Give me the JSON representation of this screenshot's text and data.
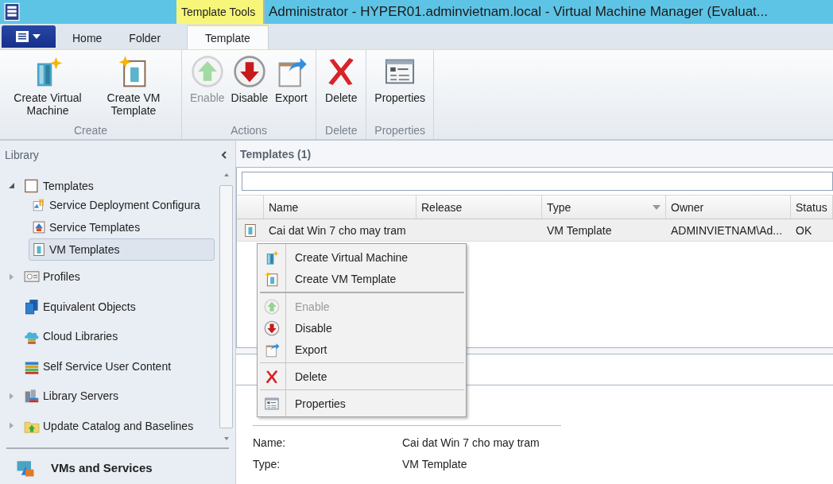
{
  "window": {
    "title": "Administrator - HYPER01.adminvietnam.local - Virtual Machine Manager (Evaluat..."
  },
  "contextual_tab_group": "Template Tools",
  "ribbon_tabs": [
    {
      "label": "Home",
      "selected": false
    },
    {
      "label": "Folder",
      "selected": false
    },
    {
      "label": "Template",
      "selected": true
    }
  ],
  "ribbon_groups": [
    {
      "label": "Create",
      "buttons": [
        {
          "label": "Create Virtual Machine",
          "kind": "server-star",
          "disabled": false
        },
        {
          "label": "Create VM Template",
          "kind": "template-star",
          "disabled": false
        }
      ]
    },
    {
      "label": "Actions",
      "buttons": [
        {
          "label": "Enable",
          "kind": "enable",
          "disabled": true
        },
        {
          "label": "Disable",
          "kind": "disable",
          "disabled": false
        },
        {
          "label": "Export",
          "kind": "export",
          "disabled": false
        }
      ]
    },
    {
      "label": "Delete",
      "buttons": [
        {
          "label": "Delete",
          "kind": "delete",
          "disabled": false
        }
      ]
    },
    {
      "label": "Properties",
      "buttons": [
        {
          "label": "Properties",
          "kind": "properties",
          "disabled": false
        }
      ]
    }
  ],
  "sidebar": {
    "title": "Library",
    "tree": [
      {
        "label": "Templates",
        "kind": "template-box",
        "expanded": true,
        "selected": false,
        "children": [
          {
            "label": "Service Deployment Configura",
            "kind": "config",
            "selected": false
          },
          {
            "label": "Service Templates",
            "kind": "service",
            "selected": false
          },
          {
            "label": "VM Templates",
            "kind": "vm-template",
            "selected": true
          }
        ]
      },
      {
        "label": "Profiles",
        "kind": "profile",
        "expanded": false,
        "selected": false
      },
      {
        "label": "Equivalent Objects",
        "kind": "equivalent",
        "selected": false
      },
      {
        "label": "Cloud Libraries",
        "kind": "cloud",
        "selected": false
      },
      {
        "label": "Self Service User Content",
        "kind": "books",
        "selected": false
      },
      {
        "label": "Library Servers",
        "kind": "servers",
        "expanded": false,
        "selected": false
      },
      {
        "label": "Update Catalog and Baselines",
        "kind": "folder-update",
        "expanded": false,
        "selected": false
      }
    ],
    "workspace": {
      "label": "VMs and Services"
    }
  },
  "list": {
    "title": "Templates (1)",
    "columns": [
      {
        "label": "Name",
        "sorted": false
      },
      {
        "label": "Release",
        "sorted": false
      },
      {
        "label": "Type",
        "sorted": true
      },
      {
        "label": "Owner",
        "sorted": false
      },
      {
        "label": "Status",
        "sorted": false
      }
    ],
    "rows": [
      {
        "name": "Cai dat Win 7 cho may tram",
        "type": "VM Template",
        "owner": "ADMINVIETNAM\\Ad...",
        "status": "OK",
        "selected": true
      }
    ]
  },
  "context_menu": [
    [
      {
        "label": "Create Virtual Machine",
        "kind": "server-star",
        "disabled": false
      },
      {
        "label": "Create VM Template",
        "kind": "template-star",
        "disabled": false
      }
    ],
    [
      {
        "label": "Enable",
        "kind": "enable",
        "disabled": true
      },
      {
        "label": "Disable",
        "kind": "disable",
        "disabled": false
      },
      {
        "label": "Export",
        "kind": "export",
        "disabled": false
      }
    ],
    [
      {
        "label": "Delete",
        "kind": "delete",
        "disabled": false
      }
    ],
    [
      {
        "label": "Properties",
        "kind": "properties",
        "disabled": false
      }
    ]
  ],
  "details": [
    {
      "label": "Name:",
      "value": "Cai dat Win 7 cho may tram"
    },
    {
      "label": "Type:",
      "value": "VM Template"
    }
  ]
}
